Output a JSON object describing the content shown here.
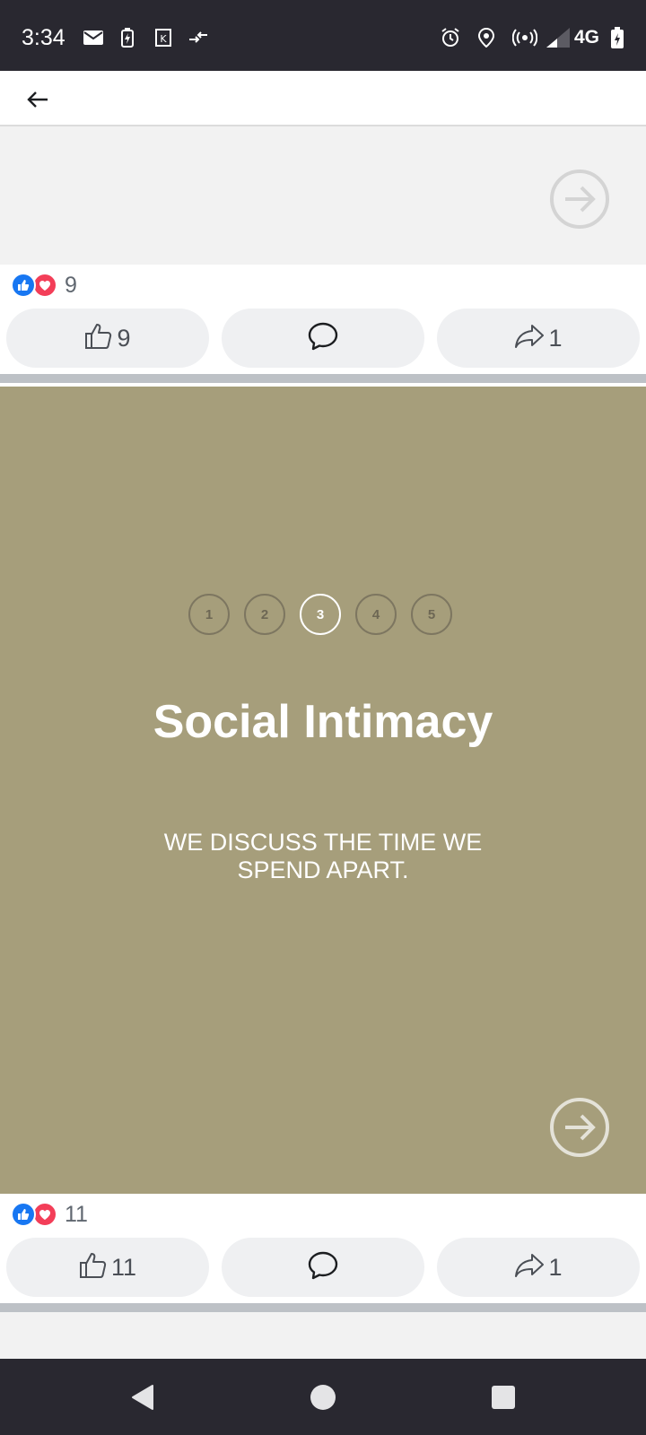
{
  "status_bar": {
    "time": "3:34",
    "network": "4G",
    "icons_left": [
      "mail-icon",
      "battery-saver-icon",
      "k-app-icon",
      "data-transfer-icon"
    ],
    "icons_right": [
      "alarm-icon",
      "location-icon",
      "hotspot-icon",
      "signal-icon",
      "battery-charging-icon"
    ]
  },
  "app_bar": {
    "back_icon": "back-arrow-icon"
  },
  "posts": [
    {
      "reaction_count": "9",
      "like_count": "9",
      "comment_count": "",
      "share_count": "1"
    },
    {
      "steps": [
        "1",
        "2",
        "3",
        "4",
        "5"
      ],
      "active_step": "3",
      "title": "Social Intimacy",
      "subtitle": "WE DISCUSS THE TIME WE SPEND APART.",
      "reaction_count": "11",
      "like_count": "11",
      "comment_count": "",
      "share_count": "1"
    }
  ],
  "colors": {
    "post_background": "#a69e7b",
    "like_blue": "#1877f2",
    "love_red": "#f33e58",
    "status_bar": "#292830"
  },
  "nav_bar": {
    "items": [
      "back-triangle-icon",
      "home-circle-icon",
      "recents-square-icon"
    ]
  }
}
